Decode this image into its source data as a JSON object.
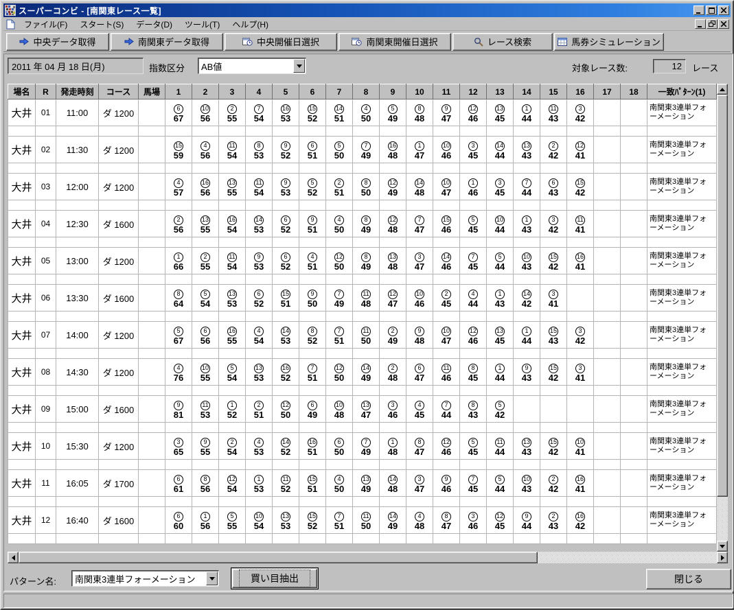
{
  "window": {
    "title": "スーパーコンビ - [南関東レース一覧]"
  },
  "menu": {
    "items": [
      "ファイル(F)",
      "スタート(S)",
      "データ(D)",
      "ツール(T)",
      "ヘルプ(H)"
    ]
  },
  "toolbar": {
    "buttons": [
      {
        "icon": "transfer-arrow-icon",
        "label": "中央データ取得"
      },
      {
        "icon": "transfer-arrow-icon",
        "label": "南関東データ取得"
      },
      {
        "icon": "calendar-select-icon",
        "label": "中央開催日選択"
      },
      {
        "icon": "calendar-select-icon",
        "label": "南関東開催日選択"
      },
      {
        "icon": "search-icon",
        "label": "レース検索"
      },
      {
        "icon": "grid-icon",
        "label": "馬券シミュレーション"
      }
    ]
  },
  "filters": {
    "date_value": "2011 年 04 月 18 日(月)",
    "index_label": "指数区分",
    "index_value": "AB値",
    "count_label": "対象レース数:",
    "count_value": "12",
    "count_unit": "レース"
  },
  "table": {
    "headers": [
      "場名",
      "R",
      "発走時刻",
      "コース",
      "馬場"
    ],
    "number_columns": [
      "1",
      "2",
      "3",
      "4",
      "5",
      "6",
      "7",
      "8",
      "9",
      "10",
      "11",
      "12",
      "13",
      "14",
      "15",
      "16",
      "17",
      "18"
    ],
    "pattern_header": "一致ﾊﾟﾀｰﾝ(1)",
    "pattern_value": "南関東3連単フォーメーション",
    "rows": [
      {
        "venue": "大井",
        "no": "01",
        "time": "11:00",
        "course": "ダ 1200",
        "going": "",
        "entries": [
          [
            6,
            67
          ],
          [
            10,
            56
          ],
          [
            2,
            55
          ],
          [
            7,
            54
          ],
          [
            16,
            53
          ],
          [
            15,
            52
          ],
          [
            14,
            51
          ],
          [
            4,
            50
          ],
          [
            5,
            49
          ],
          [
            8,
            48
          ],
          [
            9,
            47
          ],
          [
            12,
            46
          ],
          [
            13,
            45
          ],
          [
            1,
            44
          ],
          [
            11,
            43
          ],
          [
            3,
            42
          ]
        ]
      },
      {
        "venue": "大井",
        "no": "02",
        "time": "11:30",
        "course": "ダ 1200",
        "going": "",
        "entries": [
          [
            15,
            59
          ],
          [
            4,
            56
          ],
          [
            11,
            54
          ],
          [
            8,
            53
          ],
          [
            9,
            52
          ],
          [
            6,
            51
          ],
          [
            5,
            50
          ],
          [
            7,
            49
          ],
          [
            16,
            48
          ],
          [
            1,
            47
          ],
          [
            10,
            46
          ],
          [
            3,
            45
          ],
          [
            14,
            44
          ],
          [
            13,
            43
          ],
          [
            2,
            42
          ],
          [
            12,
            41
          ]
        ]
      },
      {
        "venue": "大井",
        "no": "03",
        "time": "12:00",
        "course": "ダ 1200",
        "going": "",
        "entries": [
          [
            4,
            57
          ],
          [
            16,
            56
          ],
          [
            13,
            55
          ],
          [
            11,
            54
          ],
          [
            9,
            53
          ],
          [
            5,
            52
          ],
          [
            2,
            51
          ],
          [
            8,
            50
          ],
          [
            12,
            49
          ],
          [
            14,
            48
          ],
          [
            10,
            47
          ],
          [
            1,
            46
          ],
          [
            3,
            45
          ],
          [
            7,
            44
          ],
          [
            6,
            43
          ],
          [
            15,
            42
          ]
        ]
      },
      {
        "venue": "大井",
        "no": "04",
        "time": "12:30",
        "course": "ダ 1600",
        "going": "",
        "entries": [
          [
            2,
            56
          ],
          [
            13,
            55
          ],
          [
            16,
            54
          ],
          [
            14,
            53
          ],
          [
            6,
            52
          ],
          [
            9,
            51
          ],
          [
            4,
            50
          ],
          [
            8,
            49
          ],
          [
            12,
            48
          ],
          [
            7,
            47
          ],
          [
            15,
            46
          ],
          [
            5,
            45
          ],
          [
            10,
            44
          ],
          [
            1,
            43
          ],
          [
            3,
            42
          ],
          [
            11,
            41
          ]
        ]
      },
      {
        "venue": "大井",
        "no": "05",
        "time": "13:00",
        "course": "ダ 1200",
        "going": "",
        "entries": [
          [
            1,
            66
          ],
          [
            2,
            55
          ],
          [
            11,
            54
          ],
          [
            9,
            53
          ],
          [
            6,
            52
          ],
          [
            4,
            51
          ],
          [
            12,
            50
          ],
          [
            8,
            49
          ],
          [
            13,
            48
          ],
          [
            3,
            47
          ],
          [
            14,
            46
          ],
          [
            7,
            45
          ],
          [
            5,
            44
          ],
          [
            10,
            43
          ],
          [
            15,
            42
          ],
          [
            16,
            41
          ]
        ]
      },
      {
        "venue": "大井",
        "no": "06",
        "time": "13:30",
        "course": "ダ 1600",
        "going": "",
        "entries": [
          [
            8,
            64
          ],
          [
            5,
            54
          ],
          [
            13,
            53
          ],
          [
            6,
            52
          ],
          [
            15,
            51
          ],
          [
            9,
            50
          ],
          [
            7,
            49
          ],
          [
            11,
            48
          ],
          [
            12,
            47
          ],
          [
            10,
            46
          ],
          [
            2,
            45
          ],
          [
            4,
            44
          ],
          [
            1,
            43
          ],
          [
            14,
            42
          ],
          [
            3,
            41
          ]
        ]
      },
      {
        "venue": "大井",
        "no": "07",
        "time": "14:00",
        "course": "ダ 1200",
        "going": "",
        "entries": [
          [
            5,
            67
          ],
          [
            6,
            56
          ],
          [
            16,
            55
          ],
          [
            4,
            54
          ],
          [
            14,
            53
          ],
          [
            8,
            52
          ],
          [
            7,
            51
          ],
          [
            11,
            50
          ],
          [
            2,
            49
          ],
          [
            9,
            48
          ],
          [
            10,
            47
          ],
          [
            12,
            46
          ],
          [
            13,
            45
          ],
          [
            1,
            44
          ],
          [
            15,
            43
          ],
          [
            3,
            42
          ]
        ]
      },
      {
        "venue": "大井",
        "no": "08",
        "time": "14:30",
        "course": "ダ 1200",
        "going": "",
        "entries": [
          [
            4,
            76
          ],
          [
            10,
            55
          ],
          [
            5,
            54
          ],
          [
            13,
            53
          ],
          [
            16,
            52
          ],
          [
            7,
            51
          ],
          [
            12,
            50
          ],
          [
            14,
            49
          ],
          [
            2,
            48
          ],
          [
            6,
            47
          ],
          [
            11,
            46
          ],
          [
            8,
            45
          ],
          [
            1,
            44
          ],
          [
            9,
            43
          ],
          [
            15,
            42
          ],
          [
            3,
            41
          ]
        ]
      },
      {
        "venue": "大井",
        "no": "09",
        "time": "15:00",
        "course": "ダ 1600",
        "going": "",
        "entries": [
          [
            9,
            81
          ],
          [
            11,
            53
          ],
          [
            1,
            52
          ],
          [
            2,
            51
          ],
          [
            12,
            50
          ],
          [
            6,
            49
          ],
          [
            10,
            48
          ],
          [
            13,
            47
          ],
          [
            3,
            46
          ],
          [
            4,
            45
          ],
          [
            7,
            44
          ],
          [
            8,
            43
          ],
          [
            5,
            42
          ]
        ]
      },
      {
        "venue": "大井",
        "no": "10",
        "time": "15:30",
        "course": "ダ 1200",
        "going": "",
        "entries": [
          [
            3,
            65
          ],
          [
            9,
            55
          ],
          [
            2,
            54
          ],
          [
            4,
            53
          ],
          [
            14,
            52
          ],
          [
            16,
            51
          ],
          [
            6,
            50
          ],
          [
            7,
            49
          ],
          [
            1,
            48
          ],
          [
            8,
            47
          ],
          [
            12,
            46
          ],
          [
            5,
            45
          ],
          [
            11,
            44
          ],
          [
            13,
            43
          ],
          [
            15,
            42
          ],
          [
            10,
            41
          ]
        ]
      },
      {
        "venue": "大井",
        "no": "11",
        "time": "16:05",
        "course": "ダ 1700",
        "going": "",
        "entries": [
          [
            6,
            61
          ],
          [
            8,
            56
          ],
          [
            12,
            54
          ],
          [
            1,
            53
          ],
          [
            11,
            52
          ],
          [
            15,
            51
          ],
          [
            4,
            50
          ],
          [
            13,
            49
          ],
          [
            14,
            48
          ],
          [
            3,
            47
          ],
          [
            9,
            46
          ],
          [
            7,
            45
          ],
          [
            5,
            44
          ],
          [
            10,
            43
          ],
          [
            2,
            42
          ],
          [
            16,
            41
          ]
        ]
      },
      {
        "venue": "大井",
        "no": "12",
        "time": "16:40",
        "course": "ダ 1600",
        "going": "",
        "entries": [
          [
            6,
            60
          ],
          [
            1,
            56
          ],
          [
            5,
            55
          ],
          [
            10,
            54
          ],
          [
            13,
            53
          ],
          [
            15,
            52
          ],
          [
            7,
            51
          ],
          [
            11,
            50
          ],
          [
            14,
            49
          ],
          [
            4,
            48
          ],
          [
            8,
            47
          ],
          [
            3,
            46
          ],
          [
            12,
            45
          ],
          [
            9,
            44
          ],
          [
            2,
            43
          ],
          [
            16,
            42
          ]
        ]
      }
    ]
  },
  "footer": {
    "pattern_label": "パターン名:",
    "pattern_value": "南関東3連単フォーメーション",
    "extract_button": "買い目抽出",
    "close_button": "閉じる"
  }
}
